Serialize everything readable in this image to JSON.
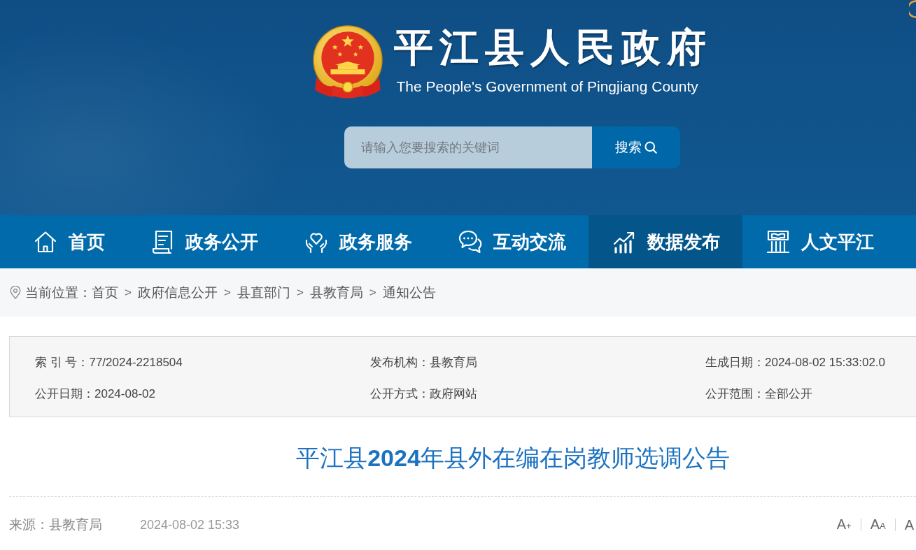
{
  "header": {
    "title": "平江县人民政府",
    "subtitle": "The People's Government of Pingjiang County"
  },
  "search": {
    "placeholder": "请输入您要搜索的关键词",
    "button": "搜索"
  },
  "nav": [
    {
      "label": "首页",
      "selected": false
    },
    {
      "label": "政务公开",
      "selected": false
    },
    {
      "label": "政务服务",
      "selected": false
    },
    {
      "label": "互动交流",
      "selected": false
    },
    {
      "label": "数据发布",
      "selected": true
    },
    {
      "label": "人文平江",
      "selected": false
    }
  ],
  "breadcrumb": {
    "label": "当前位置：",
    "items": [
      {
        "label": "首页"
      },
      {
        "separator": ">",
        "label": "政府信息公开"
      },
      {
        "separator": ">",
        "label": "县直部门"
      },
      {
        "separator": ">",
        "label": "县教育局"
      },
      {
        "separator": ">",
        "label": "通知公告"
      }
    ]
  },
  "meta": [
    {
      "label": "索 引 号：",
      "value": "77/2024-2218504"
    },
    {
      "label": "发布机构：",
      "value": "县教育局"
    },
    {
      "label": "生成日期：",
      "value": "2024-08-02 15:33:02.0"
    },
    {
      "label": "公开日期：",
      "value": "2024-08-02"
    },
    {
      "label": "公开方式：",
      "value": "政府网站"
    },
    {
      "label": "公开范围：",
      "value": "全部公开"
    }
  ],
  "article": {
    "title": "平江县**2024**年县外在编在岗教师选调公告",
    "source": "来源：县教育局",
    "date": "2024-08-02 15:33",
    "font_tools": [
      "A+",
      "AA",
      "A"
    ]
  }
}
